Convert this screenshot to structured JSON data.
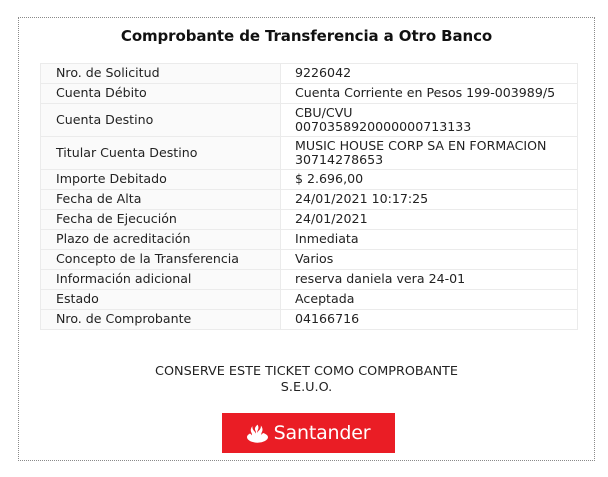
{
  "receipt": {
    "title": "Comprobante de Transferencia a Otro Banco",
    "rows": [
      {
        "label": "Nro. de Solicitud",
        "value": "9226042"
      },
      {
        "label": "Cuenta Débito",
        "value": "Cuenta Corriente en Pesos 199-003989/5"
      },
      {
        "label": "Cuenta Destino",
        "value": "CBU/CVU",
        "value2": "0070358920000000713133"
      },
      {
        "label": "Titular Cuenta Destino",
        "value": "MUSIC HOUSE CORP SA EN FORMACION",
        "value2": "30714278653"
      },
      {
        "label": "Importe Debitado",
        "value": "$ 2.696,00"
      },
      {
        "label": "Fecha de Alta",
        "value": "24/01/2021 10:17:25"
      },
      {
        "label": "Fecha de Ejecución",
        "value": "24/01/2021"
      },
      {
        "label": "Plazo de acreditación",
        "value": "Inmediata"
      },
      {
        "label": "Concepto de la Transferencia",
        "value": "Varios"
      },
      {
        "label": "Información adicional",
        "value": "reserva daniela vera 24-01"
      },
      {
        "label": "Estado",
        "value": "Aceptada"
      },
      {
        "label": "Nro. de Comprobante",
        "value": "04166716"
      }
    ],
    "notice_line1": "CONSERVE ESTE TICKET COMO COMPROBANTE",
    "notice_line2": "S.E.U.O.",
    "logo": {
      "text": "Santander",
      "icon": "flame-icon",
      "background_color": "#ea1d25",
      "text_color": "#ffffff"
    }
  }
}
